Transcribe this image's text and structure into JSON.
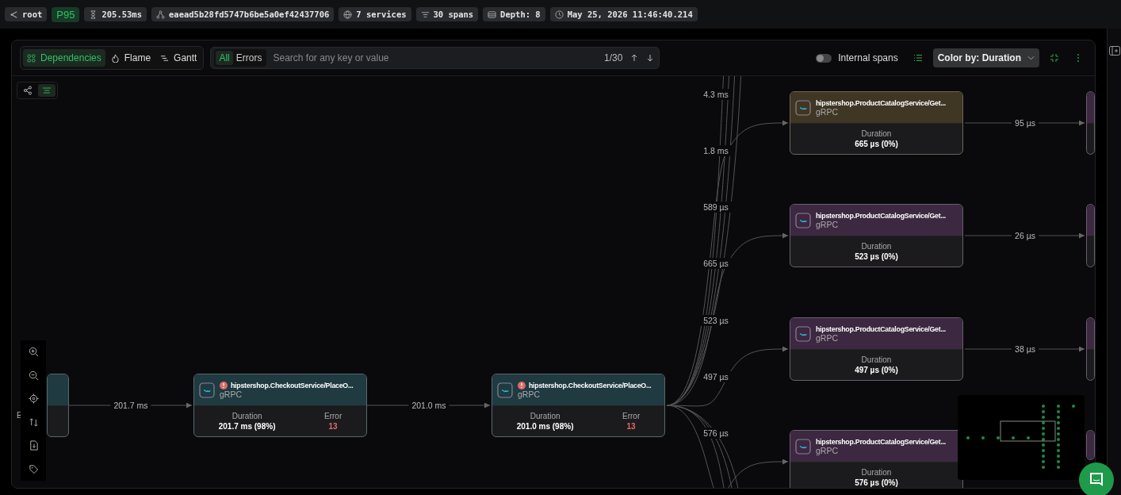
{
  "header": {
    "chips": [
      {
        "kind": "root",
        "text": "root"
      },
      {
        "kind": "percentile",
        "text": "P95"
      },
      {
        "kind": "duration",
        "text": "205.53ms"
      },
      {
        "kind": "trace",
        "text": "eaead5b28fd5747b6be5a0ef42437706"
      },
      {
        "kind": "services",
        "text": "7 services"
      },
      {
        "kind": "spans",
        "text": "30 spans"
      },
      {
        "kind": "depth",
        "text": "Depth: 8"
      },
      {
        "kind": "time",
        "text": "May 25, 2026 11:46:40.214"
      }
    ]
  },
  "toolbar": {
    "view_tabs": [
      {
        "kind": "dependencies",
        "label": "Dependencies",
        "selected": true
      },
      {
        "kind": "flame",
        "label": "Flame",
        "selected": false
      },
      {
        "kind": "gantt",
        "label": "Gantt",
        "selected": false
      }
    ],
    "filter_tabs": [
      {
        "label": "All",
        "selected": true
      },
      {
        "label": "Errors",
        "selected": false
      }
    ],
    "search": {
      "placeholder": "Search for any key or value",
      "count": "1/30"
    },
    "internal_spans": {
      "label": "Internal spans",
      "on": false
    },
    "color_by": {
      "label": "Color by: Duration"
    }
  },
  "graph": {
    "partial_node": {
      "text": "E"
    },
    "nodes": [
      {
        "title": "hipstershop.CheckoutService/PlaceO...",
        "protocol": "gRPC",
        "color": "#1f3a40",
        "error": true,
        "duration_label": "Duration",
        "duration": "201.7 ms (98%)",
        "error_label": "Error",
        "error_count": "13"
      },
      {
        "title": "hipstershop.CheckoutService/PlaceO...",
        "protocol": "gRPC",
        "color": "#1f3a40",
        "error": true,
        "duration_label": "Duration",
        "duration": "201.0 ms (98%)",
        "error_label": "Error",
        "error_count": "13"
      },
      {
        "title": "hipstershop.ProductCatalogService/Get...",
        "protocol": "gRPC",
        "color": "#3f3624",
        "error": false,
        "duration_label": "Duration",
        "duration": "665 µs (0%)"
      },
      {
        "title": "hipstershop.ProductCatalogService/Get...",
        "protocol": "gRPC",
        "color": "#3d2841",
        "error": false,
        "duration_label": "Duration",
        "duration": "523 µs (0%)"
      },
      {
        "title": "hipstershop.ProductCatalogService/Get...",
        "protocol": "gRPC",
        "color": "#3d2841",
        "error": false,
        "duration_label": "Duration",
        "duration": "497 µs (0%)"
      },
      {
        "title": "hipstershop.ProductCatalogService/Get...",
        "protocol": "gRPC",
        "color": "#3d2841",
        "error": false,
        "duration_label": "Duration",
        "duration": "576 µs (0%)"
      }
    ],
    "edge_labels": [
      "201.7 ms",
      "201.0 ms",
      "4.3 ms",
      "1.8 ms",
      "589 µs",
      "665 µs",
      "523 µs",
      "497 µs",
      "576 µs",
      "95 µs",
      "26 µs",
      "38 µs"
    ]
  }
}
